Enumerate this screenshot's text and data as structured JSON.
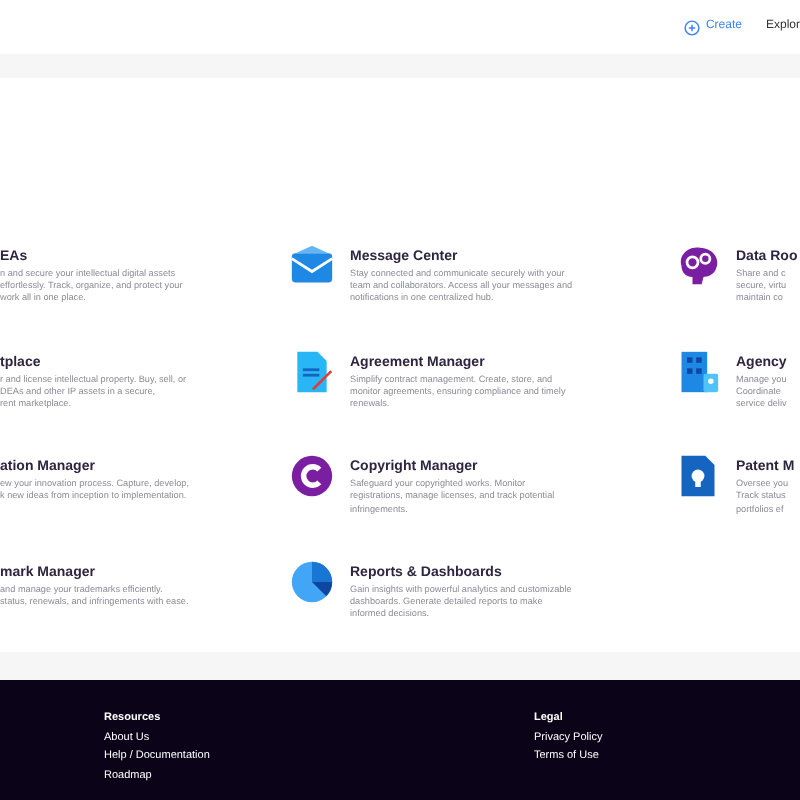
{
  "header": {
    "create": "Create",
    "explore": "Explor"
  },
  "rows": [
    {
      "cells": [
        {
          "kind": "text",
          "title": "EAs",
          "lines": [
            "n and secure your intellectual digital assets",
            "effortlessly. Track, organize, and protect your",
            "work all in one place."
          ]
        },
        {
          "kind": "envelope",
          "title": "Message Center",
          "lines": [
            "Stay connected and communicate securely with your",
            "team and collaborators. Access all your messages and",
            "notifications in one centralized hub."
          ]
        },
        {
          "kind": "brain",
          "title": "Data Roo",
          "lines": [
            "Share and c",
            "secure, virtu",
            "maintain co"
          ]
        }
      ]
    },
    {
      "cells": [
        {
          "kind": "text",
          "title": "tplace",
          "lines": [
            "r and license intellectual property. Buy, sell, or",
            "DEAs and other IP assets in a secure,",
            "rent marketplace."
          ]
        },
        {
          "kind": "contract",
          "title": "Agreement Manager",
          "lines": [
            "Simplify contract management. Create, store, and",
            "monitor agreements, ensuring compliance and timely",
            "renewals."
          ]
        },
        {
          "kind": "building",
          "title": "Agency",
          "lines": [
            "Manage you",
            "Coordinate",
            "service deliv"
          ]
        }
      ]
    },
    {
      "cells": [
        {
          "kind": "text",
          "title": "ation Manager",
          "lines": [
            "ew your innovation process. Capture, develop,",
            "k new ideas from inception to implementation."
          ]
        },
        {
          "kind": "copyright",
          "title": "Copyright Manager",
          "lines": [
            "Safeguard your copyrighted works. Monitor",
            "registrations, manage licenses, and track potential",
            "infringements."
          ]
        },
        {
          "kind": "bulb",
          "title": "Patent M",
          "lines": [
            "Oversee you",
            "Track status",
            "portfolios ef"
          ]
        }
      ]
    },
    {
      "cells": [
        {
          "kind": "text",
          "title": "mark Manager",
          "lines": [
            "and manage your trademarks efficiently.",
            "status, renewals, and infringements with ease."
          ]
        },
        {
          "kind": "pie",
          "title": "Reports & Dashboards",
          "lines": [
            "Gain insights with powerful analytics and customizable",
            "dashboards. Generate detailed reports to make",
            "informed decisions."
          ]
        }
      ]
    }
  ],
  "footer": [
    {
      "heading": "Resources",
      "links": [
        "About Us",
        "Help / Documentation",
        "Roadmap"
      ]
    },
    {
      "heading": "Legal",
      "links": [
        "Privacy Policy",
        "Terms of Use"
      ]
    }
  ]
}
